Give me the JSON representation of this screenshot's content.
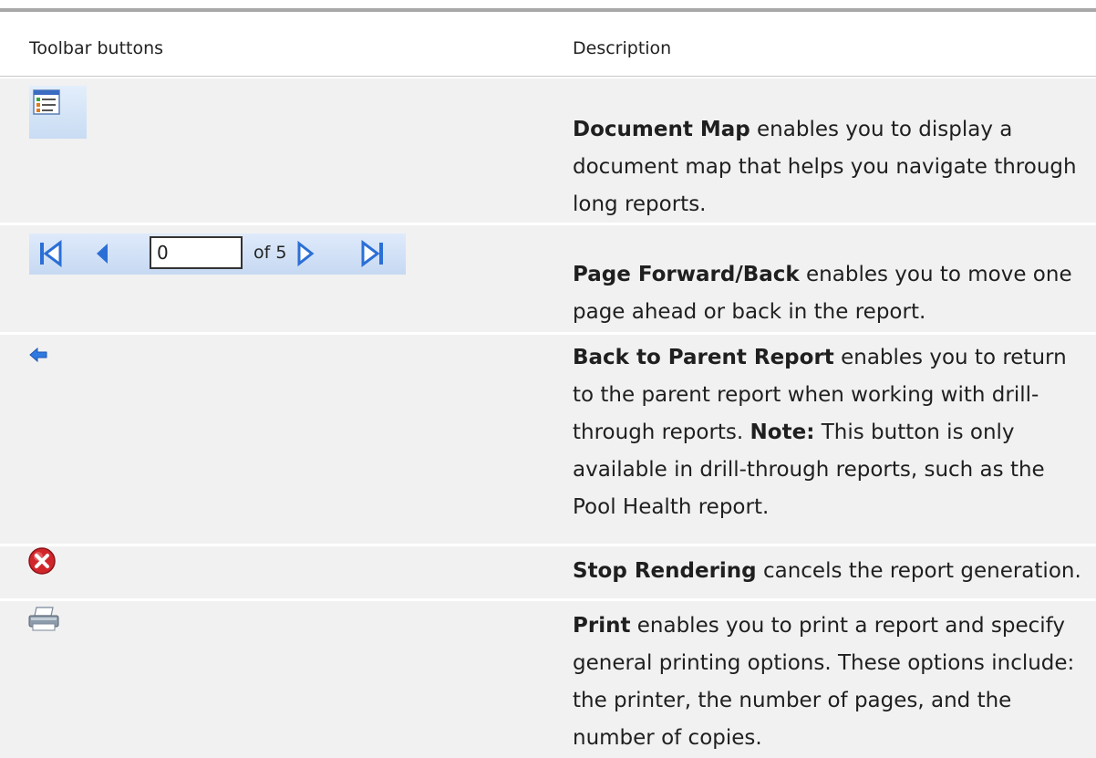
{
  "table": {
    "headers": {
      "toolbar": "Toolbar buttons",
      "description": "Description"
    },
    "rows": [
      {
        "icon": "document-map-icon",
        "title": "Document Map",
        "text": " enables you to display a document map that helps you navigate through long reports."
      },
      {
        "icon": "page-navigation-toolbar",
        "title": "Page Forward/Back",
        "text": " enables you to move one page ahead or back in the report.",
        "pager": {
          "current_page": "0",
          "of_label": "of 5"
        }
      },
      {
        "icon": "back-arrow-icon",
        "title": "Back to Parent Report",
        "text": " enables you to return to the parent report when working with drill-through reports. ",
        "note_label": "Note:",
        "note_text": " This button is only available in drill-through reports, such as the Pool Health report."
      },
      {
        "icon": "stop-icon",
        "title": "Stop Rendering",
        "text": " cancels the report generation."
      },
      {
        "icon": "printer-icon",
        "title": "Print",
        "text": " enables you to print a report and specify general printing options. These options include: the printer, the number of pages, and the number of copies."
      }
    ]
  },
  "colors": {
    "row_background": "#f1f1f1",
    "toolbar_blue": "#2b6fd6",
    "stop_red": "#d0262b"
  }
}
